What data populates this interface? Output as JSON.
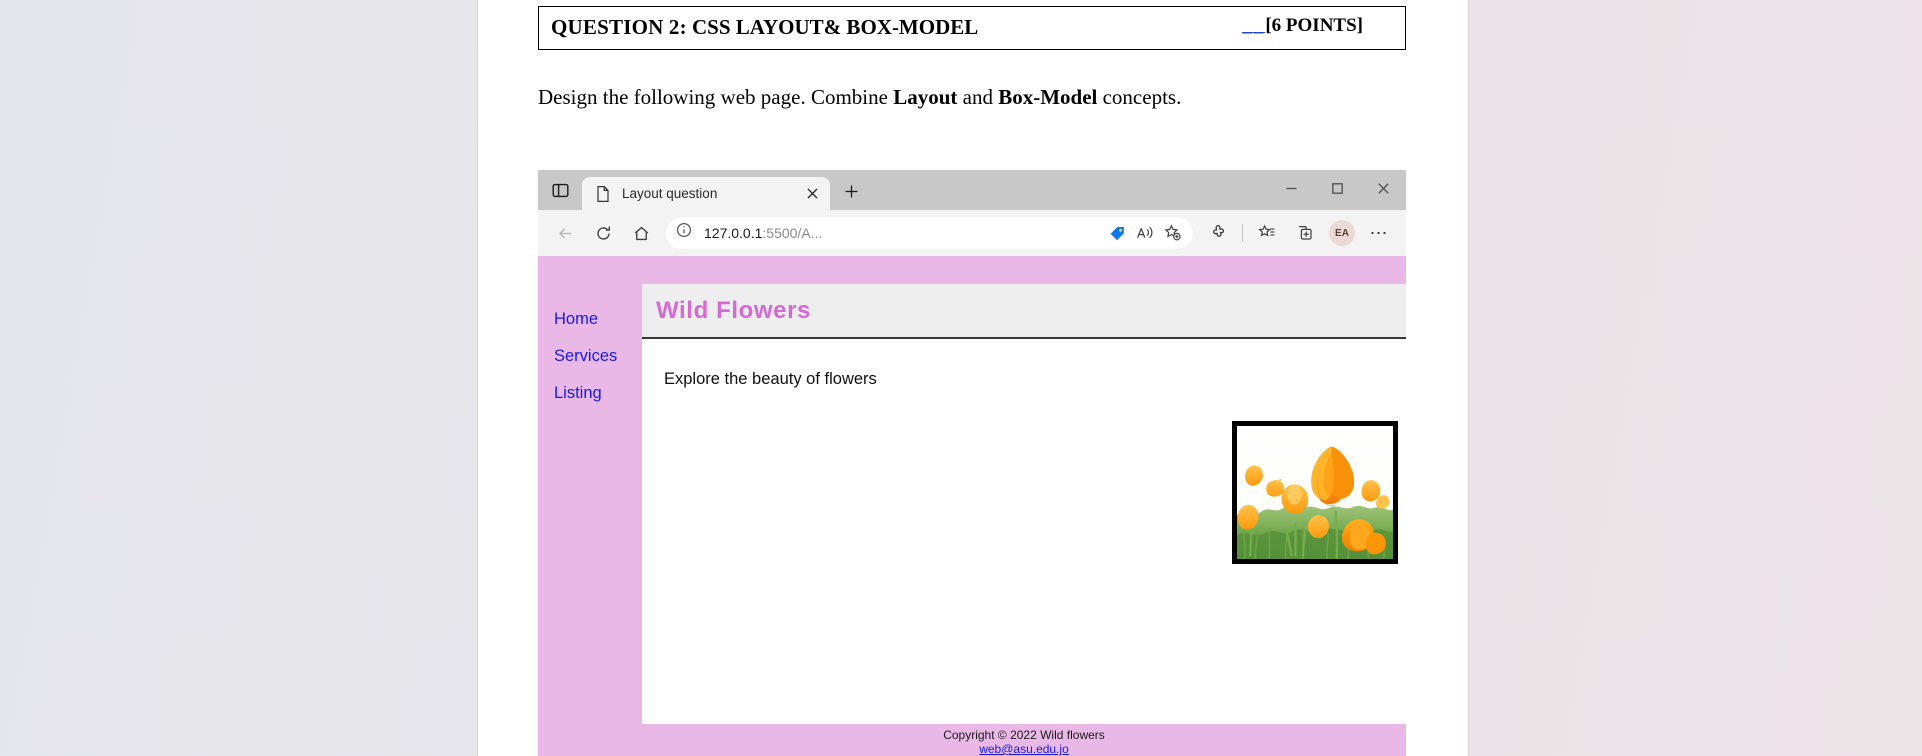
{
  "document": {
    "question": {
      "label": "QUESTION 2:",
      "topic": "CSS LAYOUT& BOX-MODEL",
      "points_underline": "__",
      "points": "[6 POINTS]"
    },
    "instruction": {
      "part1": "Design the following web page. Combine ",
      "bold1": "Layout",
      "part2": " and ",
      "bold2": "Box-Model",
      "part3": " concepts."
    }
  },
  "browser": {
    "name": "Microsoft Edge",
    "tab_search_icon": "split-pane-icon",
    "tab": {
      "favicon": "page-document-icon",
      "title": "Layout question",
      "close_icon": "close-icon"
    },
    "new_tab_label": "+",
    "window_controls": {
      "minimize": "minimize-icon",
      "maximize": "maximize-icon",
      "close": "close-icon"
    },
    "toolbar": {
      "back_icon": "back-arrow-icon",
      "refresh_icon": "refresh-icon",
      "home_icon": "home-icon",
      "info_icon": "info-circle-icon",
      "url_host": "127.0.0.1",
      "url_rest": ":5500/A...",
      "shopping_icon": "price-tag-icon",
      "read_aloud_icon": "read-aloud-icon",
      "add_favorite_icon": "star-plus-icon",
      "extensions_icon": "puzzle-piece-icon",
      "favorites_icon": "favorites-star-list-icon",
      "collections_icon": "collections-icon",
      "profile_initials": "EA",
      "settings_icon": "more-dots-icon"
    }
  },
  "webpage": {
    "nav": [
      {
        "label": "Home"
      },
      {
        "label": "Services"
      },
      {
        "label": "Listing"
      }
    ],
    "header_title": "Wild Flowers",
    "tagline": "Explore the beauty of flowers",
    "photo_alt": "orange-wild-flowers-photo",
    "footer": {
      "copyright": "Copyright © 2022 Wild flowers",
      "email": "web@asu.edu.jo"
    },
    "colors": {
      "sidebar_pink": "#e9b8e6",
      "title_orchid": "#d569d5",
      "link_blue": "#1a1ae6",
      "header_gray": "#eeeeee"
    }
  }
}
